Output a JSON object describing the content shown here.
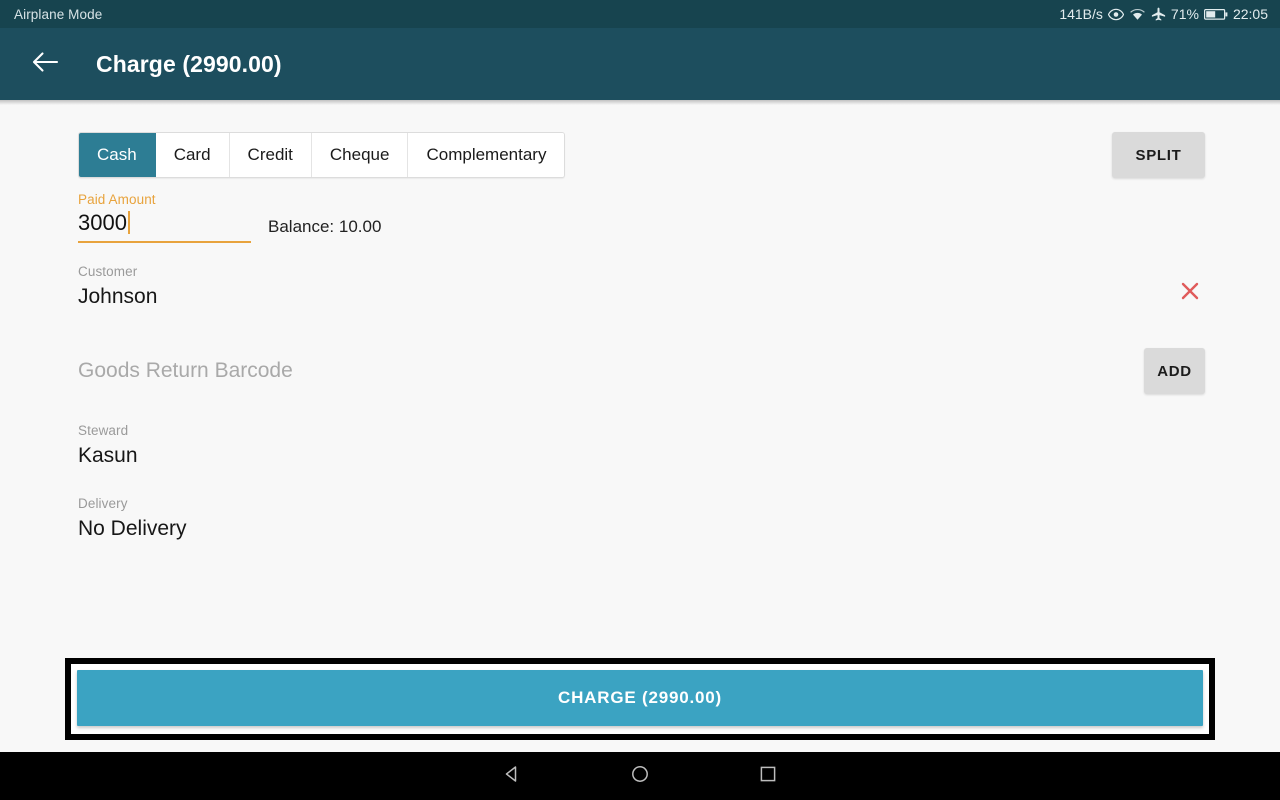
{
  "status_bar": {
    "left_text": "Airplane Mode",
    "network_speed": "141B/s",
    "battery_percent": "71%",
    "clock": "22:05",
    "icons": [
      "eye-icon",
      "wifi-icon",
      "airplane-icon",
      "battery-icon"
    ],
    "background": "#17444f"
  },
  "toolbar": {
    "back_icon": "back-arrow-icon",
    "title": "Charge (2990.00)",
    "background": "#1d4e5e"
  },
  "payment_tabs": {
    "selected": "Cash",
    "accent": "#2d7d94",
    "items": [
      {
        "label": "Cash"
      },
      {
        "label": "Card"
      },
      {
        "label": "Credit"
      },
      {
        "label": "Cheque"
      },
      {
        "label": "Complementary"
      }
    ]
  },
  "split_button": {
    "label": "SPLIT"
  },
  "paid_amount": {
    "label": "Paid Amount",
    "value": "3000",
    "accent": "#e8a33d",
    "balance_text": "Balance: 10.00"
  },
  "customer": {
    "label": "Customer",
    "value": "Johnson",
    "clear_icon": "close-x-icon",
    "clear_color": "#e05b5b"
  },
  "goods_return": {
    "placeholder": "Goods Return Barcode",
    "value": "",
    "add_label": "ADD"
  },
  "steward": {
    "label": "Steward",
    "value": "Kasun"
  },
  "delivery": {
    "label": "Delivery",
    "value": "No Delivery"
  },
  "charge_button": {
    "label": "CHARGE (2990.00)",
    "color": "#3ba3c2",
    "focused": true
  },
  "nav_bar": {
    "back": "nav-back-icon",
    "home": "nav-home-icon",
    "recents": "nav-recents-icon"
  }
}
